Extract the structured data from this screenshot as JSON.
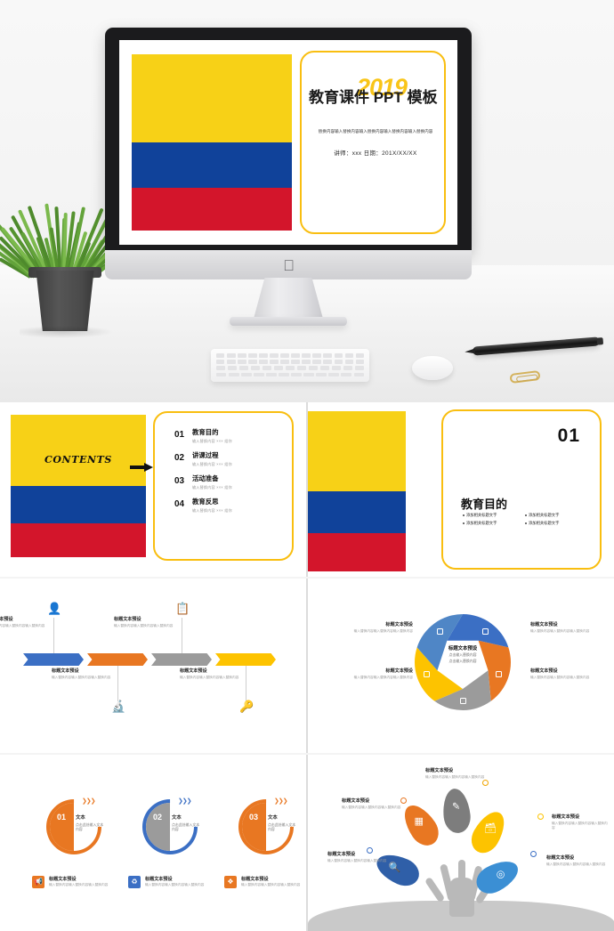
{
  "palette": {
    "yellow": "#F7D117",
    "frame_yellow": "#F9BE10",
    "blue": "#10429A",
    "red": "#D3152B",
    "accent_blue": "#3B6FC4",
    "accent_orange": "#E87722",
    "accent_gray": "#9B9B9B",
    "accent_yellow": "#FDC300"
  },
  "hero": {
    "device": "imac-monitor",
    "props": [
      "potted-plant",
      "keyboard",
      "mouse",
      "pen",
      "paperclip"
    ]
  },
  "title_slide": {
    "year": "2019",
    "title": "教育课件 PPT 模板",
    "subtitle": "替换内容输入替换内容输入替换内容输入替换内容输入替换内容",
    "meta": "讲师：xxx    日期：201X/XX/XX"
  },
  "contents_slide": {
    "word": "CONTENTS",
    "items": [
      {
        "num": "01",
        "title": "教育目的",
        "desc": "输入替换内容 ××× 组你"
      },
      {
        "num": "02",
        "title": "讲课过程",
        "desc": "输入替换内容 ××× 组你"
      },
      {
        "num": "03",
        "title": "活动准备",
        "desc": "输入替换内容 ××× 组你"
      },
      {
        "num": "04",
        "title": "教育反思",
        "desc": "输入替换内容 ××× 组你"
      }
    ]
  },
  "section_slide": {
    "number": "01",
    "title": "教育目的",
    "bullets": [
      "添加相关标题文字",
      "添加相关标题文字",
      "添加相关标题文字",
      "添加相关标题文字"
    ]
  },
  "process_slide": {
    "arrows": [
      {
        "color": "#3B6FC4",
        "icon": "person-icon",
        "position": "above",
        "title": "标题文本预设",
        "desc": "输入替换内容输入替换内容输入替换内容"
      },
      {
        "color": "#E87722",
        "icon": "flask-icon",
        "position": "below",
        "title": "标题文本预设",
        "desc": "输入替换内容输入替换内容输入替换内容"
      },
      {
        "color": "#9B9B9B",
        "icon": "clipboard-icon",
        "position": "above",
        "title": "标题文本预设",
        "desc": "输入替换内容输入替换内容输入替换内容"
      },
      {
        "color": "#FDC300",
        "icon": "lock-icon",
        "position": "below",
        "title": "标题文本预设",
        "desc": "输入替换内容输入替换内容输入替换内容"
      }
    ]
  },
  "pentagon_slide": {
    "center": {
      "title": "标题文本预设",
      "line1": "点击输入替换内容",
      "line2": "点击输入替换内容"
    },
    "petals": [
      {
        "color": "#3B6FC4",
        "icon": "gear-icon"
      },
      {
        "color": "#E87722",
        "icon": "badge-icon"
      },
      {
        "color": "#9B9B9B",
        "icon": "minus-box-icon"
      },
      {
        "color": "#FDC300",
        "icon": "document-icon"
      },
      {
        "color": "#4F86C6",
        "icon": "calculator-icon"
      }
    ],
    "labels": [
      {
        "title": "标题文本预设",
        "desc": "输入替换内容输入替换内容输入替换内容"
      },
      {
        "title": "标题文本预设",
        "desc": "输入替换内容输入替换内容输入替换内容"
      },
      {
        "title": "标题文本预设",
        "desc": "输入替换内容输入替换内容输入替换内容"
      },
      {
        "title": "标题文本预设",
        "desc": "输入替换内容输入替换内容输入替换内容"
      }
    ]
  },
  "circles_slide": {
    "circles": [
      {
        "num": "01",
        "color": "#E87722",
        "half": "#E87722",
        "label": "文本",
        "desc": "点击此处输入文本内容"
      },
      {
        "num": "02",
        "color": "#3B6FC4",
        "half": "#9B9B9B",
        "label": "文本",
        "desc": "点击此处输入文本内容"
      },
      {
        "num": "03",
        "color": "#E87722",
        "half": "#E87722",
        "label": "文本",
        "desc": "点击此处输入文本内容"
      }
    ],
    "legends": [
      {
        "color": "#E87722",
        "icon": "megaphone-icon",
        "title": "标题文本预设",
        "desc": "输入替换内容输入替换内容输入替换内容"
      },
      {
        "color": "#3B6FC4",
        "icon": "recycle-icon",
        "title": "标题文本预设",
        "desc": "输入替换内容输入替换内容输入替换内容"
      },
      {
        "color": "#E87722",
        "icon": "network-icon",
        "title": "标题文本预设",
        "desc": "输入替换内容输入替换内容输入替换内容"
      }
    ]
  },
  "tree_slide": {
    "leaves": [
      {
        "color": "#E87722",
        "icon": "qr-icon"
      },
      {
        "color": "#7D7D7D",
        "icon": "pencil-icon"
      },
      {
        "color": "#FDC300",
        "icon": "database-icon"
      },
      {
        "color": "#2F5FA8",
        "icon": "search-icon"
      },
      {
        "color": "#3B8FD4",
        "icon": "target-icon"
      }
    ],
    "labels": [
      {
        "title": "标题文本预设",
        "desc": "输入替换内容输入替换内容输入替换内容",
        "dot": "#F0A500"
      },
      {
        "title": "标题文本预设",
        "desc": "输入替换内容输入替换内容输入替换内容",
        "dot": "#E87722"
      },
      {
        "title": "标题文本预设",
        "desc": "输入替换内容输入替换内容输入替换内容",
        "dot": "#FDC300"
      },
      {
        "title": "标题文本预设",
        "desc": "输入替换内容输入替换内容输入替换内容",
        "dot": "#3B6FC4"
      },
      {
        "title": "标题文本预设",
        "desc": "输入替换内容输入替换内容输入替换内容",
        "dot": "#3B6FC4"
      }
    ]
  }
}
